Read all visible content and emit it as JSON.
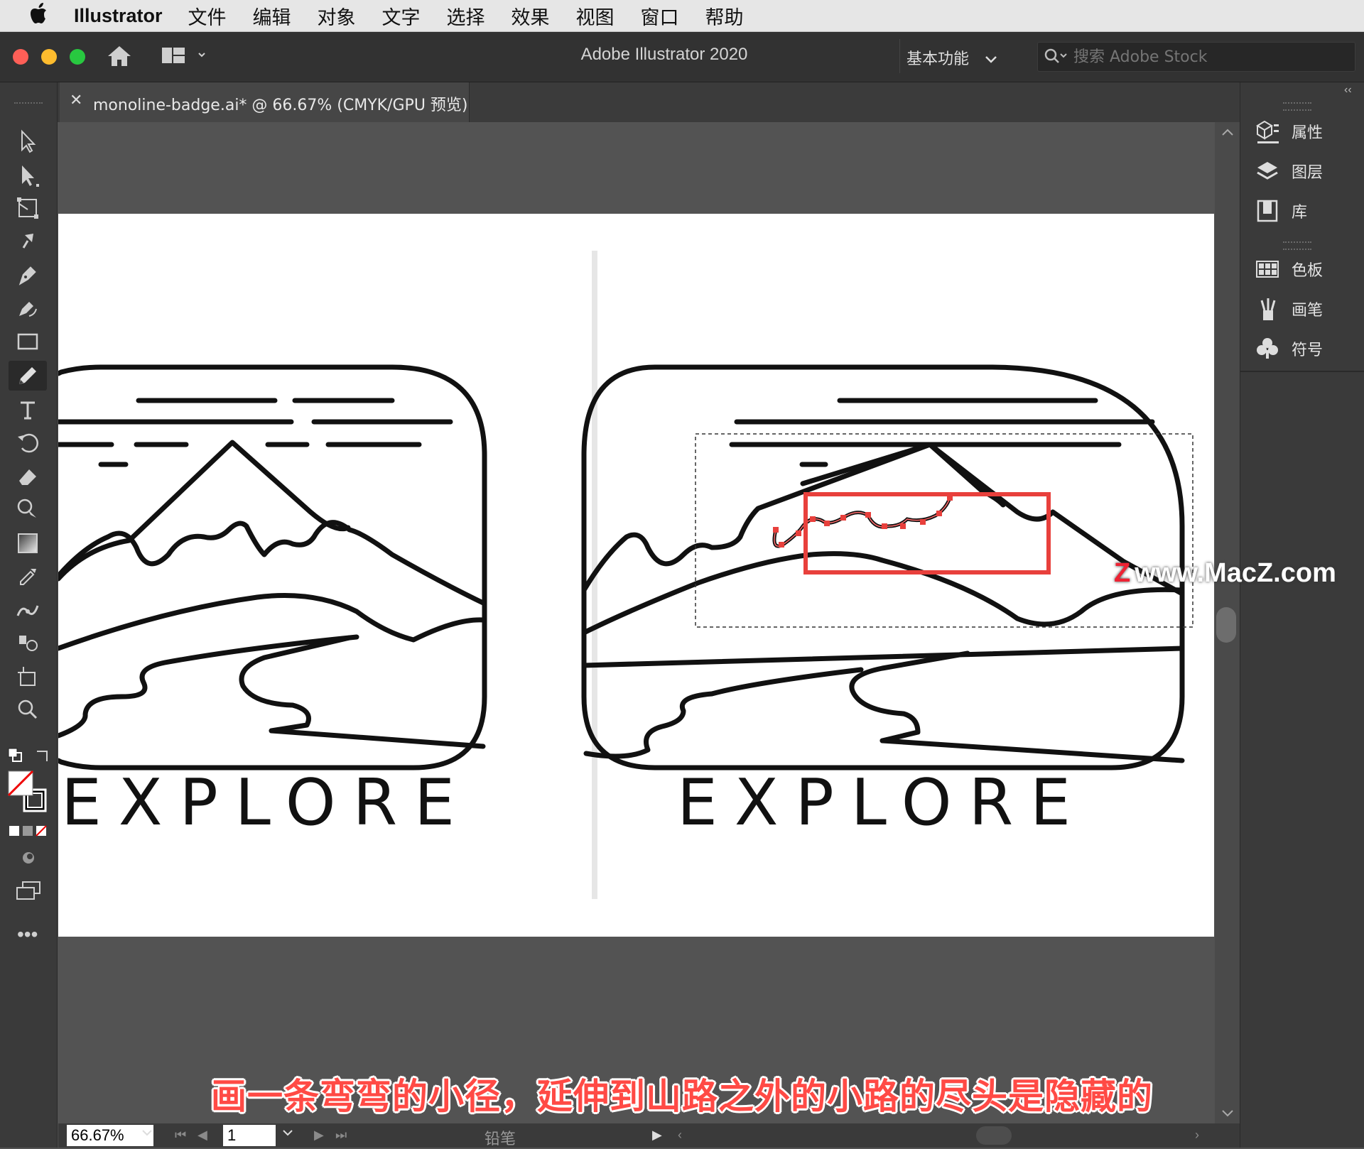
{
  "menubar": {
    "app_name": "Illustrator",
    "items": [
      "文件",
      "编辑",
      "对象",
      "文字",
      "选择",
      "效果",
      "视图",
      "窗口",
      "帮助"
    ]
  },
  "appbar": {
    "title": "Adobe Illustrator 2020",
    "workspace": "基本功能",
    "search_placeholder": "搜索 Adobe Stock"
  },
  "document_tab": {
    "label": "monoline-badge.ai* @ 66.67% (CMYK/GPU 预览)"
  },
  "toolbar": {
    "active_tool": "pencil",
    "tools": [
      "selection-tool",
      "direct-selection-tool",
      "free-transform-tool",
      "puppet-warp-tool",
      "pen-tool",
      "curvature-tool",
      "rectangle-tool",
      "pencil-tool",
      "type-tool",
      "rotate-tool",
      "eraser-tool",
      "shape-builder-tool",
      "gradient-tool",
      "eyedropper-tool",
      "width-tool",
      "symbol-sprayer-tool",
      "artboard-tool",
      "zoom-tool"
    ]
  },
  "right_panel": {
    "group1": [
      {
        "label": "属性",
        "icon": "properties-icon"
      },
      {
        "label": "图层",
        "icon": "layers-icon"
      },
      {
        "label": "库",
        "icon": "libraries-icon"
      }
    ],
    "group2": [
      {
        "label": "色板",
        "icon": "swatches-icon"
      },
      {
        "label": "画笔",
        "icon": "brushes-icon"
      },
      {
        "label": "符号",
        "icon": "symbols-icon"
      }
    ]
  },
  "artboard": {
    "left_badge_text": "EXPLORE",
    "right_badge_text": "EXPLORE"
  },
  "statusbar": {
    "zoom": "66.67%",
    "page": "1",
    "tool_name": "铅笔"
  },
  "overlay": {
    "subtitle": "画一条弯弯的小径，延伸到山路之外的小路的尽头是隐藏的",
    "watermark": "www.MacZ.com",
    "watermark_logo": "Z"
  },
  "colors": {
    "highlight_box": "#e8403c",
    "subtitle": "#ff4a45",
    "app_chrome": "#323232"
  }
}
